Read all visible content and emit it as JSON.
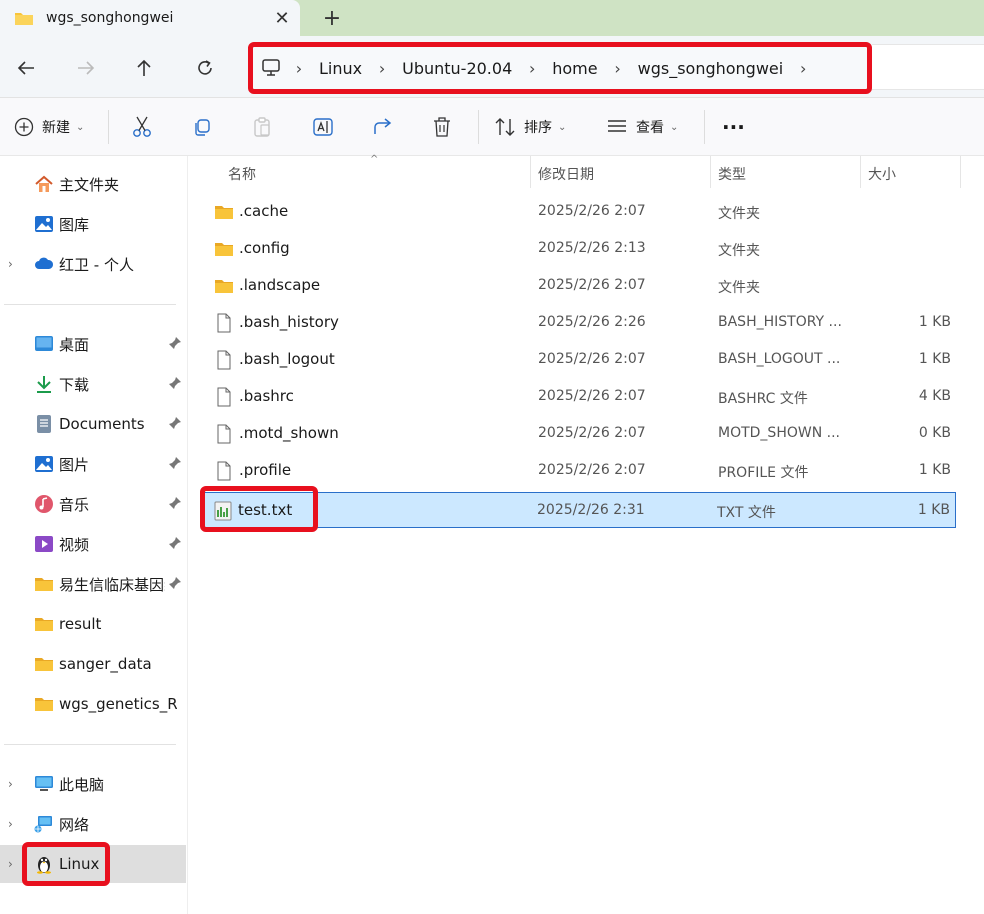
{
  "tab": {
    "title": "wgs_songhongwei",
    "close_glyph": "✕",
    "new_tab_glyph": "+"
  },
  "breadcrumb": {
    "separator": "›",
    "items": [
      "Linux",
      "Ubuntu-20.04",
      "home",
      "wgs_songhongwei"
    ]
  },
  "toolbar": {
    "new_label": "新建",
    "sort_label": "排序",
    "view_label": "查看",
    "more_label": "···"
  },
  "sidebar": {
    "quick": [
      {
        "label": "主文件夹",
        "icon": "home-icon"
      },
      {
        "label": "图库",
        "icon": "gallery-icon"
      },
      {
        "label": "红卫 - 个人",
        "icon": "cloud-icon",
        "expandable": true
      }
    ],
    "pinned": [
      {
        "label": "桌面",
        "icon": "desktop-icon",
        "pinned": true
      },
      {
        "label": "下载",
        "icon": "download-icon",
        "pinned": true
      },
      {
        "label": "Documents",
        "icon": "documents-icon",
        "pinned": true
      },
      {
        "label": "图片",
        "icon": "pictures-icon",
        "pinned": true
      },
      {
        "label": "音乐",
        "icon": "music-icon",
        "pinned": true
      },
      {
        "label": "视频",
        "icon": "video-icon",
        "pinned": true
      },
      {
        "label": "易生信临床基因组",
        "icon": "folder-icon",
        "pinned": true
      },
      {
        "label": "result",
        "icon": "folder-icon"
      },
      {
        "label": "sanger_data",
        "icon": "folder-icon"
      },
      {
        "label": "wgs_genetics_R",
        "icon": "folder-icon"
      }
    ],
    "devices": [
      {
        "label": "此电脑",
        "icon": "computer-icon",
        "expandable": true
      },
      {
        "label": "网络",
        "icon": "network-icon",
        "expandable": true
      },
      {
        "label": "Linux",
        "icon": "linux-penguin-icon",
        "expandable": true,
        "selected": true
      }
    ]
  },
  "columns": {
    "name": "名称",
    "date": "修改日期",
    "type": "类型",
    "size": "大小"
  },
  "files": [
    {
      "name": ".cache",
      "date": "2025/2/26 2:07",
      "type": "文件夹",
      "size": "",
      "kind": "folder"
    },
    {
      "name": ".config",
      "date": "2025/2/26 2:13",
      "type": "文件夹",
      "size": "",
      "kind": "folder"
    },
    {
      "name": ".landscape",
      "date": "2025/2/26 2:07",
      "type": "文件夹",
      "size": "",
      "kind": "folder"
    },
    {
      "name": ".bash_history",
      "date": "2025/2/26 2:26",
      "type": "BASH_HISTORY ...",
      "size": "1 KB",
      "kind": "file"
    },
    {
      "name": ".bash_logout",
      "date": "2025/2/26 2:07",
      "type": "BASH_LOGOUT ...",
      "size": "1 KB",
      "kind": "file"
    },
    {
      "name": ".bashrc",
      "date": "2025/2/26 2:07",
      "type": "BASHRC 文件",
      "size": "4 KB",
      "kind": "file"
    },
    {
      "name": ".motd_shown",
      "date": "2025/2/26 2:07",
      "type": "MOTD_SHOWN ...",
      "size": "0 KB",
      "kind": "file"
    },
    {
      "name": ".profile",
      "date": "2025/2/26 2:07",
      "type": "PROFILE 文件",
      "size": "1 KB",
      "kind": "file"
    },
    {
      "name": "test.txt",
      "date": "2025/2/26 2:31",
      "type": "TXT 文件",
      "size": "1 KB",
      "kind": "txt",
      "selected": true
    }
  ],
  "colors": {
    "highlight_red": "#e8101e",
    "selection_bg": "#cce8ff",
    "folder_yellow": "#f8c43a"
  }
}
